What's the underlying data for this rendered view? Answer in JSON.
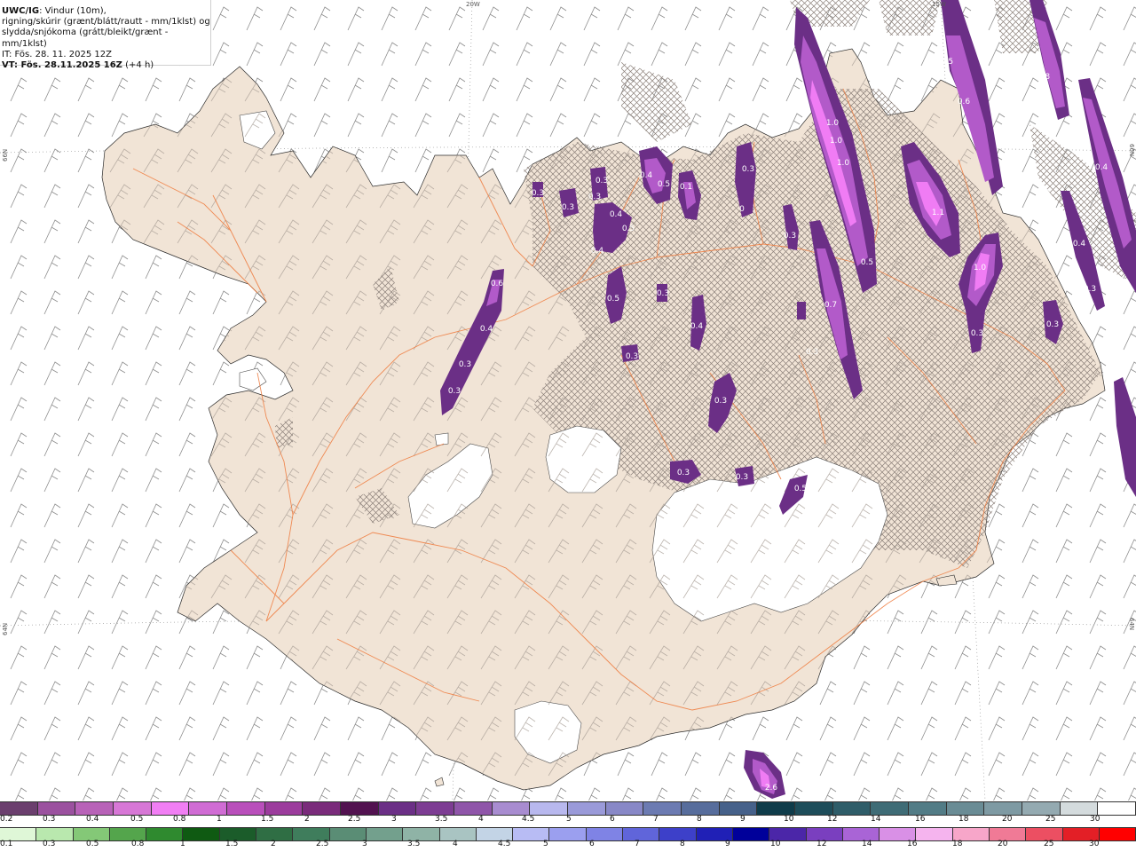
{
  "header": {
    "product": "UWC/IG",
    "line1_rest": ": Vindur (10m),",
    "line2": "rigning/skúrir (grænt/blátt/rautt - mm/1klst) og",
    "line3": "slydda/snjókoma (grátt/bleikt/grænt - mm/1klst)",
    "init_time": "IT: Fös. 28. 11. 2025 12Z",
    "valid_time": "VT: Fös. 28.11.2025 16Z",
    "lead": " (+4 h)"
  },
  "grid_labels": {
    "lon_20w": "20W",
    "lon_15w": "15W",
    "lat_66n_left": "66N",
    "lat_66n_right": "66N",
    "lat_64n_left": "64N",
    "lat_64n_right": "64N"
  },
  "colors": {
    "land": "#f1e4d6",
    "sea": "#ffffff",
    "roads": "#ef7a3c",
    "glacier": "#ffffff",
    "snow_dark": "#6b2f86",
    "snow_mid": "#b25ac9",
    "snow_light": "#f07cf4"
  },
  "precip_labels": [
    "0.3",
    "0.3",
    "0.3",
    "0.4",
    "0.5",
    "0.1",
    "0.3",
    "0.4",
    "0.5",
    "0.4",
    "0.5",
    "0.3",
    "0.6",
    "0.4",
    "0.3",
    "0.3",
    "0.3",
    "0.4",
    "0.3",
    "0.3",
    "0.3",
    "0.5",
    "0.7",
    "0.3",
    "0.3",
    "0",
    "1.0",
    "1.0",
    "1.0",
    "0.5",
    "1.1",
    "1.0",
    "0.3",
    "0.5",
    "0.6",
    "0.8",
    "0.4",
    "0.4",
    "0.3",
    "2.6",
    "0.3",
    "0.3"
  ],
  "legend_snow": {
    "colors": [
      "#6b3f6e",
      "#9b519f",
      "#b862b8",
      "#d777d6",
      "#f17ef4",
      "#d06cd4",
      "#b94fbb",
      "#9c3c9d",
      "#7a2b7b",
      "#521250",
      "#6b2f86",
      "#7d3c93",
      "#8f55a9",
      "#a88cd0",
      "#b8b8ee",
      "#9a9ad9",
      "#8888c7",
      "#6c7bb2",
      "#576d9c",
      "#46618a",
      "#0f3c4a",
      "#1e4d5a",
      "#2f5d69",
      "#3f6c76",
      "#527c86",
      "#6a8c95",
      "#7e9aa3",
      "#94aab1",
      "#d4dbdd",
      "#ffffff"
    ],
    "labels": [
      "0.2",
      "0.3",
      "0.4",
      "0.5",
      "0.8",
      "1",
      "1.5",
      "2",
      "2.5",
      "3",
      "3.5",
      "4",
      "4.5",
      "5",
      "6",
      "7",
      "8",
      "9",
      "10",
      "12",
      "14",
      "16",
      "18",
      "20",
      "25",
      "30"
    ]
  },
  "legend_rain": {
    "colors": [
      "#dff7d7",
      "#b9e8ae",
      "#84c877",
      "#54a54c",
      "#2f8a2f",
      "#0f5a12",
      "#1b5c2a",
      "#2f6e44",
      "#3f7d5c",
      "#5a8d75",
      "#73a08d",
      "#8fb3a6",
      "#a9c4c2",
      "#c3d4e6",
      "#b8bcf4",
      "#9b9fef",
      "#7f83e5",
      "#6065da",
      "#3d40c9",
      "#2020b6",
      "#00009a",
      "#4b26a8",
      "#7a3fbf",
      "#a964d6",
      "#d990e6",
      "#f5b4ee",
      "#f7a6c9",
      "#f07a96",
      "#ec4f62",
      "#e31f26",
      "#ff0000"
    ],
    "labels": [
      "0.1",
      "0.3",
      "0.5",
      "0.8",
      "1",
      "1.5",
      "2",
      "2.5",
      "3",
      "3.5",
      "4",
      "4.5",
      "5",
      "6",
      "7",
      "8",
      "9",
      "10",
      "12",
      "14",
      "16",
      "18",
      "20",
      "25",
      "30"
    ]
  }
}
